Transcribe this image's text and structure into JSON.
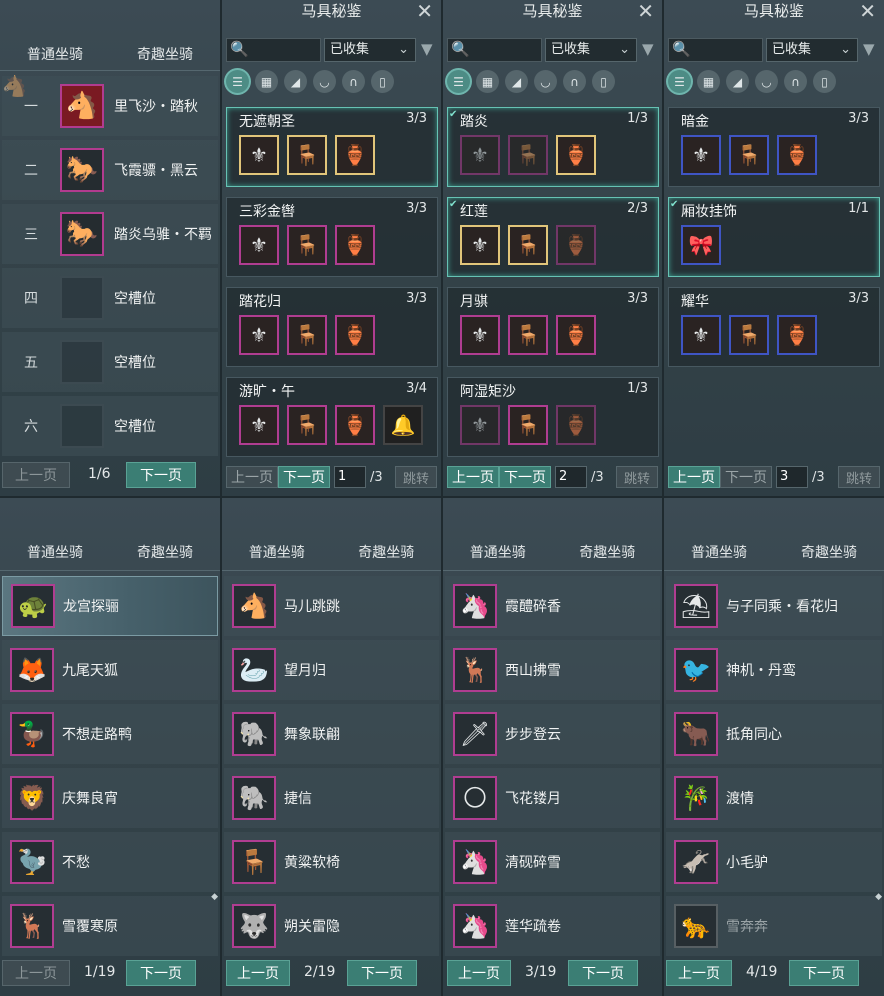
{
  "mount_tabs": {
    "normal": "普通坐骑",
    "fun": "奇趣坐骑"
  },
  "slots": {
    "rows": [
      {
        "num": "一",
        "name": "里飞沙・踏秋",
        "icon": "🐴"
      },
      {
        "num": "二",
        "name": "飞霞骠・黑云",
        "icon": "🐎"
      },
      {
        "num": "三",
        "name": "踏炎乌骓・不羁",
        "icon": "🐎"
      },
      {
        "num": "四",
        "name": "空槽位",
        "icon": ""
      },
      {
        "num": "五",
        "name": "空槽位",
        "icon": ""
      },
      {
        "num": "六",
        "name": "空槽位",
        "icon": ""
      }
    ],
    "prev": "上一页",
    "next": "下一页",
    "page": "1/6"
  },
  "tack": {
    "title": "马具秘鉴",
    "close": "✕",
    "filter_value": "已收集",
    "search_icon": "🔍",
    "prev": "上一页",
    "next": "下一页",
    "jump": "跳转",
    "panels": [
      {
        "page": "1",
        "total": "/3",
        "cards": [
          {
            "name": "无遮朝圣",
            "count": "3/3",
            "items": [
              "⚜",
              "🪑",
              "🏺"
            ]
          },
          {
            "name": "三彩金辔",
            "count": "3/3",
            "items": [
              "⚜",
              "🪑",
              "🏺"
            ]
          },
          {
            "name": "踏花归",
            "count": "3/3",
            "items": [
              "⚜",
              "🪑",
              "🏺"
            ]
          },
          {
            "name": "游旷・午",
            "count": "3/4",
            "items": [
              "⚜",
              "🪑",
              "🏺",
              "🔔"
            ]
          }
        ]
      },
      {
        "page": "2",
        "total": "/3",
        "cards": [
          {
            "name": "踏炎",
            "count": "1/3",
            "items": [
              "⚜",
              "🪑",
              "🏺"
            ]
          },
          {
            "name": "红莲",
            "count": "2/3",
            "items": [
              "⚜",
              "🪑",
              "🏺"
            ]
          },
          {
            "name": "月骐",
            "count": "3/3",
            "items": [
              "⚜",
              "🪑",
              "🏺"
            ]
          },
          {
            "name": "阿湿矩沙",
            "count": "1/3",
            "items": [
              "⚜",
              "🪑",
              "🏺"
            ]
          }
        ]
      },
      {
        "page": "3",
        "total": "/3",
        "cards": [
          {
            "name": "暗金",
            "count": "3/3",
            "items": [
              "⚜",
              "🪑",
              "🏺"
            ]
          },
          {
            "name": "厢妆挂饰",
            "count": "1/1",
            "items": [
              "🎀"
            ]
          },
          {
            "name": "耀华",
            "count": "3/3",
            "items": [
              "⚜",
              "🪑",
              "🏺"
            ]
          }
        ]
      }
    ]
  },
  "fun_lists": [
    {
      "page": "1/19",
      "items": [
        {
          "name": "龙宫探骊",
          "icon": "🐢"
        },
        {
          "name": "九尾天狐",
          "icon": "🦊"
        },
        {
          "name": "不想走路鸭",
          "icon": "🦆"
        },
        {
          "name": "庆舞良宵",
          "icon": "🦁"
        },
        {
          "name": "不愁",
          "icon": "🦤"
        },
        {
          "name": "雪覆寒原",
          "icon": "🦌"
        }
      ]
    },
    {
      "page": "2/19",
      "items": [
        {
          "name": "马儿跳跳",
          "icon": "🐴"
        },
        {
          "name": "望月归",
          "icon": "🦢"
        },
        {
          "name": "舞象联翩",
          "icon": "🐘"
        },
        {
          "name": "捷信",
          "icon": "🐘"
        },
        {
          "name": "黄粱软椅",
          "icon": "🪑"
        },
        {
          "name": "朔关雷隐",
          "icon": "🐺"
        }
      ]
    },
    {
      "page": "3/19",
      "items": [
        {
          "name": "霞醴碎香",
          "icon": "🦄"
        },
        {
          "name": "西山拂雪",
          "icon": "🦌"
        },
        {
          "name": "步步登云",
          "icon": "🗡"
        },
        {
          "name": "飞花镂月",
          "icon": "🌕"
        },
        {
          "name": "清砚碎雪",
          "icon": "🦄"
        },
        {
          "name": "莲华疏卷",
          "icon": "🦄"
        }
      ]
    },
    {
      "page": "4/19",
      "items": [
        {
          "name": "与子同乘・看花归",
          "icon": "⛱"
        },
        {
          "name": "神机・丹鸾",
          "icon": "🐦"
        },
        {
          "name": "抵角同心",
          "icon": "🐂"
        },
        {
          "name": "渡情",
          "icon": "🎋"
        },
        {
          "name": "小毛驴",
          "icon": "🫏"
        },
        {
          "name": "雪奔奔",
          "icon": "🐆"
        }
      ]
    }
  ]
}
